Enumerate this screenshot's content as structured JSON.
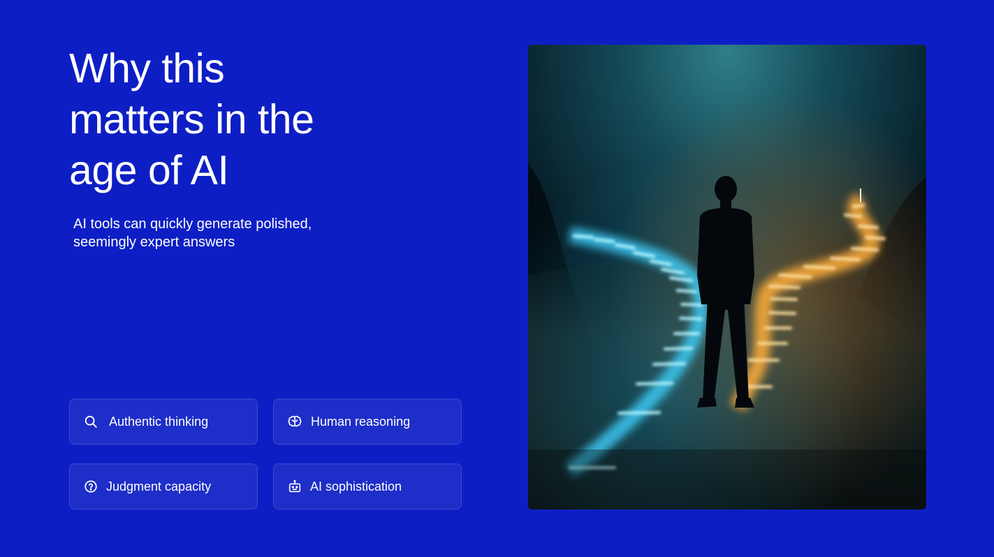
{
  "headline": {
    "line1": "Why this",
    "line2": "matters in the",
    "line3": "age of AI"
  },
  "subtitle": {
    "line1": "AI tools can quickly generate polished,",
    "line2": "seemingly expert answers"
  },
  "cards": [
    {
      "label": "Authentic thinking",
      "icon": "search-icon"
    },
    {
      "label": "Human reasoning",
      "icon": "brain-icon"
    },
    {
      "label": "Judgment capacity",
      "icon": "question-circle-icon"
    },
    {
      "label": "AI sophistication",
      "icon": "robot-icon"
    }
  ],
  "colors": {
    "background": "#0d1fc4",
    "text": "#ffffff",
    "path_cyan": "#4fe3ff",
    "path_amber": "#ffb347"
  },
  "image": {
    "subject": "silhouetted person standing at a fork between a glowing cyan path and a glowing amber path"
  }
}
